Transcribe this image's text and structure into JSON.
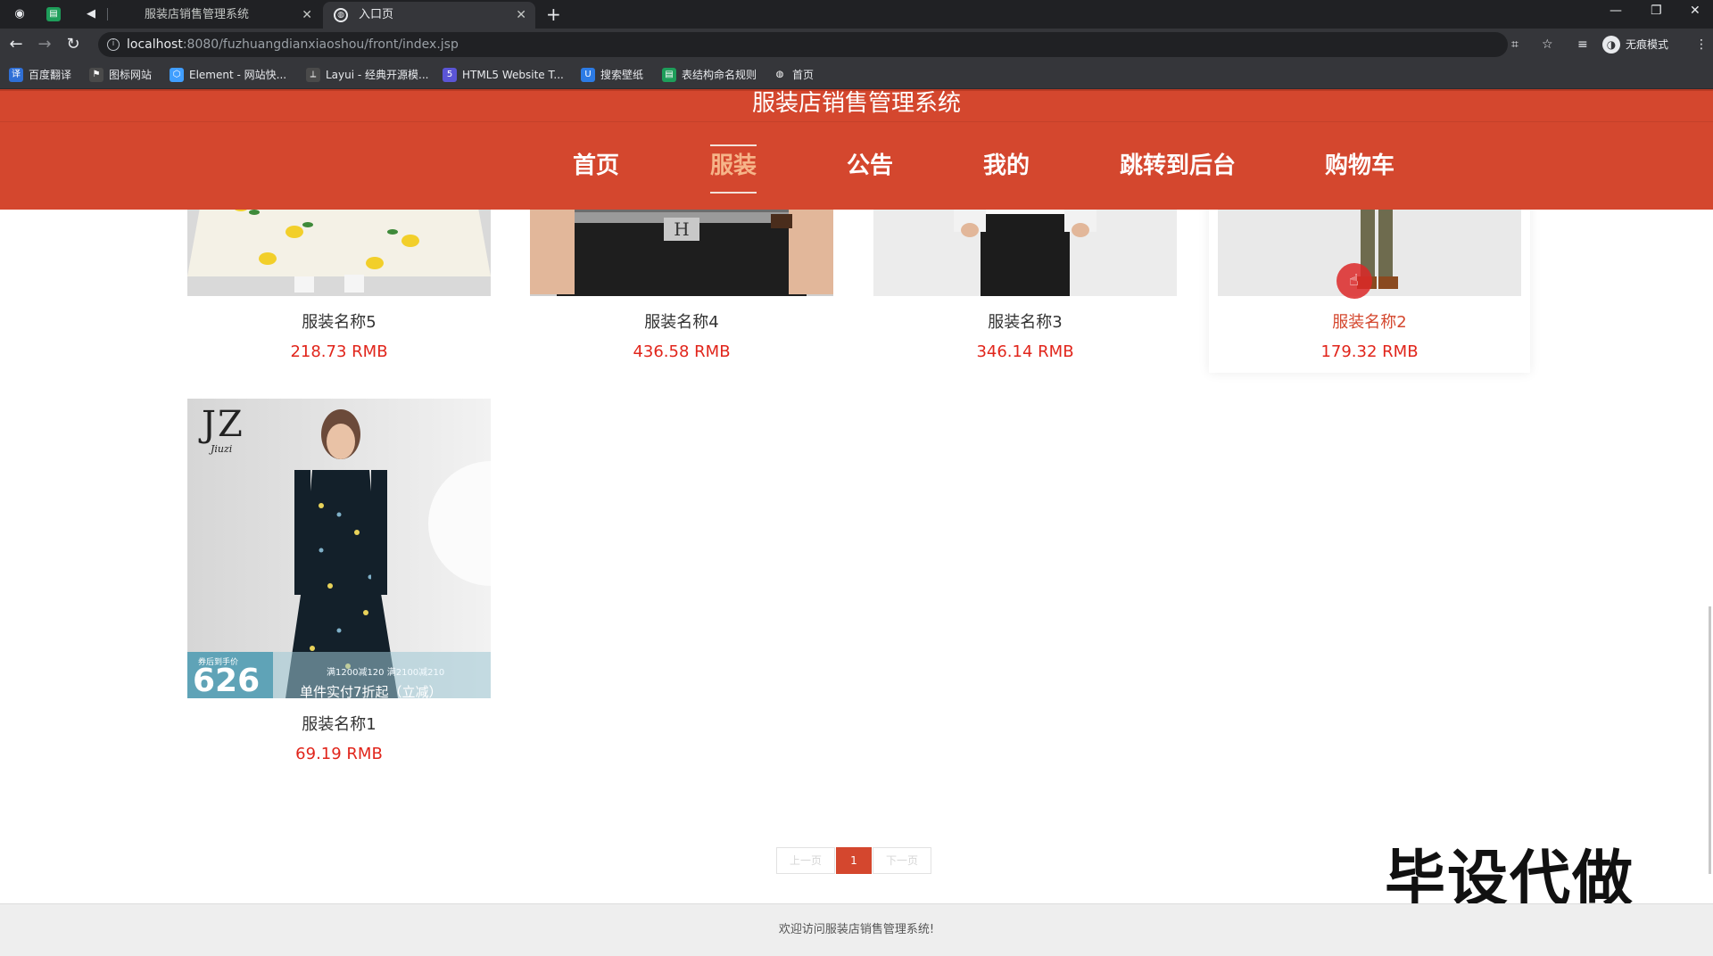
{
  "browser": {
    "tabs": [
      {
        "title": "服装店销售管理系统",
        "active": false
      },
      {
        "title": "入口页",
        "active": true
      }
    ],
    "address": {
      "host": "localhost",
      "path": ":8080/fuzhuangdianxiaoshou/front/index.jsp"
    },
    "incognito_label": "无痕模式",
    "bookmarks": [
      {
        "label": "百度翻译",
        "icon": "translate-icon",
        "color": "#2f6fd6"
      },
      {
        "label": "图标网站",
        "icon": "flag-icon",
        "color": "#4a4a4a"
      },
      {
        "label": "Element - 网站快...",
        "icon": "element-icon",
        "color": "#409eff"
      },
      {
        "label": "Layui - 经典开源模...",
        "icon": "layui-icon",
        "color": "#4a4a4a"
      },
      {
        "label": "HTML5 Website T...",
        "icon": "html5-icon",
        "color": "#5b55d6"
      },
      {
        "label": "搜索壁纸",
        "icon": "wallpaper-icon",
        "color": "#2c7be5"
      },
      {
        "label": "表结构命名规则",
        "icon": "sheet-icon",
        "color": "#1e9e5a"
      },
      {
        "label": "首页",
        "icon": "globe-icon",
        "color": "#35363a"
      }
    ]
  },
  "site": {
    "title": "服装店销售管理系统",
    "nav": [
      "首页",
      "服装",
      "公告",
      "我的",
      "跳转到后台",
      "购物车"
    ],
    "active_nav": "服装",
    "accent": "#d4472e",
    "price_color": "#e1251b"
  },
  "products": [
    {
      "name": "服装名称5",
      "price": "218.73 RMB"
    },
    {
      "name": "服装名称4",
      "price": "436.58 RMB"
    },
    {
      "name": "服装名称3",
      "price": "346.14 RMB"
    },
    {
      "name": "服装名称2",
      "price": "179.32 RMB",
      "hovered": true
    },
    {
      "name": "服装名称1",
      "price": "69.19 RMB",
      "image_text": {
        "brand": "JZ",
        "brand_sub": "Jiuzi",
        "badge": "券后到手价",
        "price": "626",
        "promo": "满1200减120  满2100减210",
        "promo2": "单件实付7折起（立减）"
      }
    }
  ],
  "pagination": {
    "prev": "上一页",
    "current": "1",
    "next": "下一页"
  },
  "watermark": "毕设代做",
  "footer": "欢迎访问服装店销售管理系统!"
}
